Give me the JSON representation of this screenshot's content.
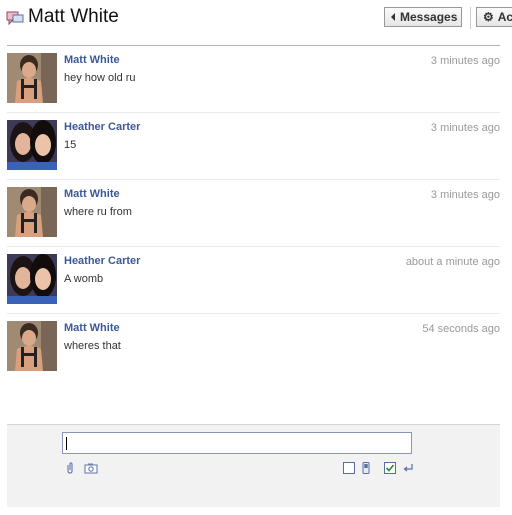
{
  "header": {
    "title": "Matt White",
    "messages_label": "Messages",
    "actions_label": "Ac"
  },
  "messages": [
    {
      "sender": "Matt White",
      "time": "3 minutes ago",
      "text": "hey how old ru"
    },
    {
      "sender": "Heather Carter",
      "time": "3 minutes ago",
      "text": "15"
    },
    {
      "sender": "Matt White",
      "time": "3 minutes ago",
      "text": "where ru from"
    },
    {
      "sender": "Heather Carter",
      "time": "about a minute ago",
      "text": "A womb"
    },
    {
      "sender": "Matt White",
      "time": "54 seconds ago",
      "text": "wheres that"
    }
  ],
  "composer": {
    "value": "",
    "icons": [
      "paperclip-icon",
      "camera-icon",
      "checkbox-icon",
      "phone-icon",
      "checked-checkbox-icon",
      "enter-icon"
    ],
    "enter_to_send": true
  },
  "colors": {
    "link": "#3b5998",
    "muted": "#999999",
    "composer_bg": "#f2f2f2"
  }
}
